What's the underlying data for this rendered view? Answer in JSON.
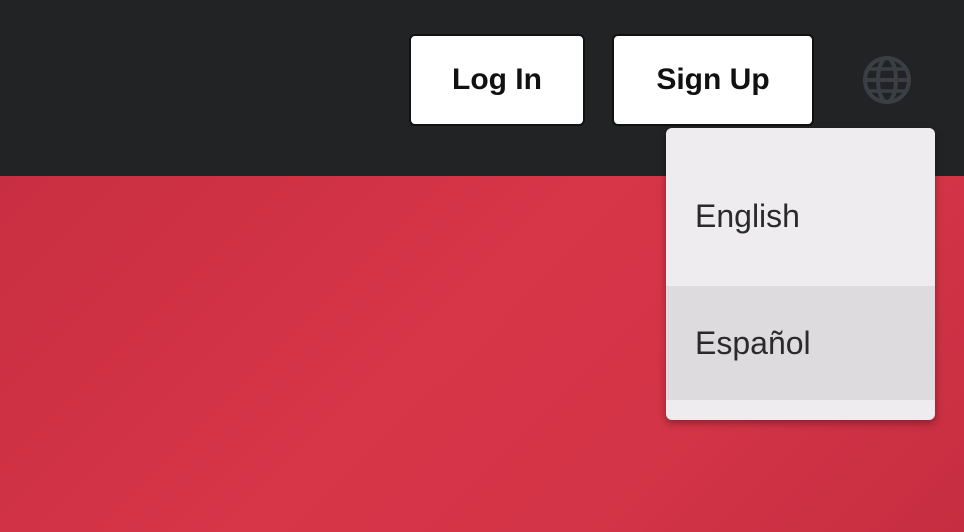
{
  "header": {
    "login_label": "Log In",
    "signup_label": "Sign Up",
    "language_icon": "globe-icon"
  },
  "language_menu": {
    "items": [
      {
        "label": "English"
      },
      {
        "label": "Español"
      }
    ]
  },
  "colors": {
    "header_bg": "#222324",
    "hero_bg": "#d43447",
    "button_bg": "#ffffff",
    "menu_bg": "#eeecef",
    "menu_hover_bg": "#dedbde",
    "globe": "#3b3e44"
  }
}
